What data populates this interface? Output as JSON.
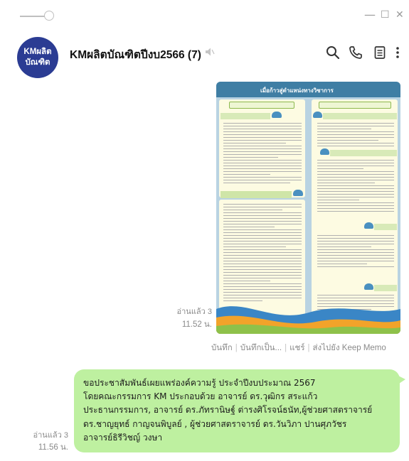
{
  "window": {
    "controls": [
      "—",
      "☐",
      "✕"
    ]
  },
  "header": {
    "avatar_line1": "KMผลิต",
    "avatar_line2": "บัณฑิต",
    "title": "KMผลิตบัณฑิตปีงบ2566 (7)",
    "icons": [
      "mute-icon",
      "search-icon",
      "phone-icon",
      "notes-icon",
      "more-icon"
    ]
  },
  "image_message": {
    "banner": "เมื่อก้าวสู่ตำแหน่งทางวิชาการ",
    "read": "อ่านแล้ว 3",
    "time": "11.52 น.",
    "actions": [
      "บันทึก",
      "บันทึกเป็น...",
      "แชร์",
      "ส่งไปยัง Keep Memo"
    ]
  },
  "text_message": {
    "lines": [
      "ขอประชาสัมพันธ์เผยแพร่องค์ความรู้ ประจำปีงบประมาณ 2567",
      "โดยคณะกรรมการ KM ประกอบด้วย อาจารย์ ดร.วุฒิกร สระแก้ว",
      "ประธานกรรมการ, อาจารย์ ดร.ภัทรานิษฐ์  ต่ารงศิโรจน์ธนัท,ผู้ช่วยศาสตราจารย์",
      "ดร.ชาญยุทธ์  กาญจนพิบูลย์ , ผู้ช่วยศาสตราจารย์ ดร.วันวิภา ปานศุภวัชร",
      "อาจารย์ธิรีวิชญ์ วงษา"
    ],
    "read": "อ่านแล้ว 3",
    "time": "11.56 น."
  },
  "colors": {
    "accent": "#2b3c93",
    "bubble": "#bef0a0"
  }
}
